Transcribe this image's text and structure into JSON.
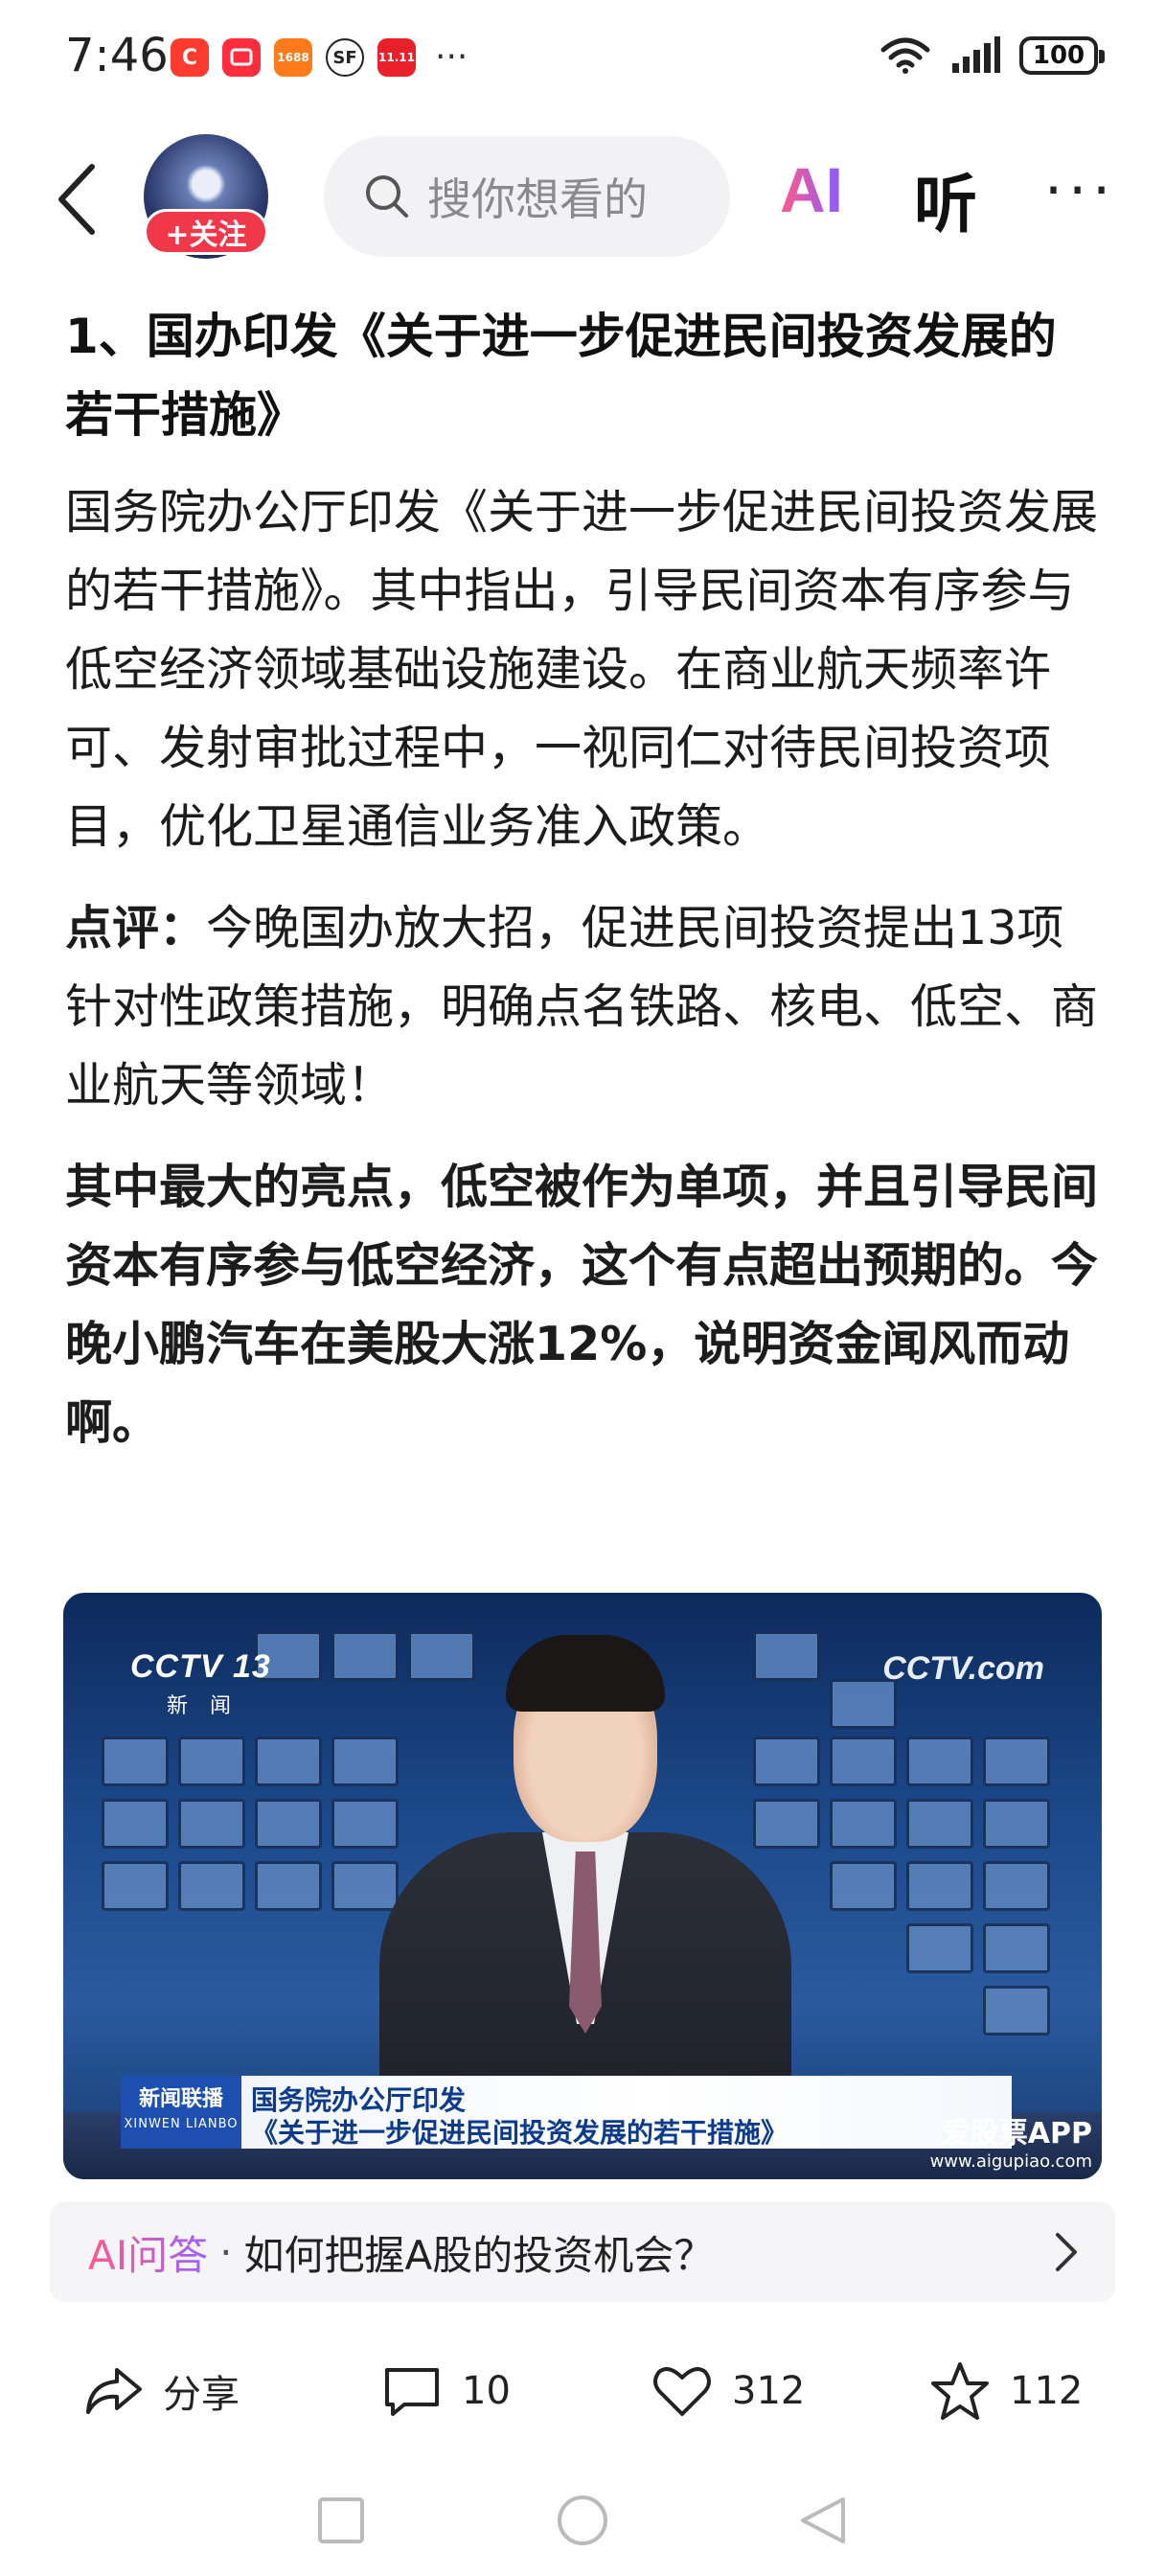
{
  "status_bar": {
    "time": "7:46",
    "apps": [
      {
        "icon": "app-c-icon",
        "label": "C",
        "color": "#ff3b30"
      },
      {
        "icon": "app-message-icon",
        "label": "",
        "color": "#ff2d3d"
      },
      {
        "icon": "app-1688-icon",
        "label": "1688",
        "color": "#ff7a1a"
      },
      {
        "icon": "app-sf-icon",
        "label": "SF",
        "color": "#222222"
      },
      {
        "icon": "app-taobao-icon",
        "label": "11.11",
        "color": "#e8202a"
      }
    ],
    "more": "···",
    "battery": "100"
  },
  "header": {
    "follow_label": "+关注",
    "search_placeholder": "搜你想看的",
    "ai_label": "AI",
    "listen_label": "听",
    "more_label": "···"
  },
  "article": {
    "title": "1、国办印发《关于进一步促进民间投资发展的若干措施》",
    "para1": "国务院办公厅印发《关于进一步促进民间投资发展的若干措施》。其中指出，引导民间资本有序参与低空经济领域基础设施建设。在商业航天频率许可、发射审批过程中，一视同仁对待民间投资项目，优化卫星通信业务准入政策。",
    "comment_label": "点评：",
    "comment_text": "今晚国办放大招，促进民间投资提出13项针对性政策措施，明确点名铁路、核电、低空、商业航天等领域！",
    "para3": "其中最大的亮点，低空被作为单项，并且引导民间资本有序参与低空经济，这个有点超出预期的。今晚小鹏汽车在美股大涨12%，说明资金闻风而动啊。"
  },
  "news_image": {
    "channel_logo": "CCTV 13",
    "channel_sub": "新 闻",
    "right_logo": "CCTV.com",
    "badge_line1": "新闻联播",
    "badge_line2": "XINWEN LIANBO",
    "caption_line1": "国务院办公厅印发",
    "caption_line2": "《关于进一步促进民间投资发展的若干措施》",
    "watermark": "爱股票APP",
    "watermark_url": "www.aigupiao.com"
  },
  "ai_qa": {
    "tag": "AI问答",
    "dot": "·",
    "question": "如何把握A股的投资机会？"
  },
  "actions": {
    "share": "分享",
    "comments": "10",
    "likes": "312",
    "favorites": "112"
  }
}
